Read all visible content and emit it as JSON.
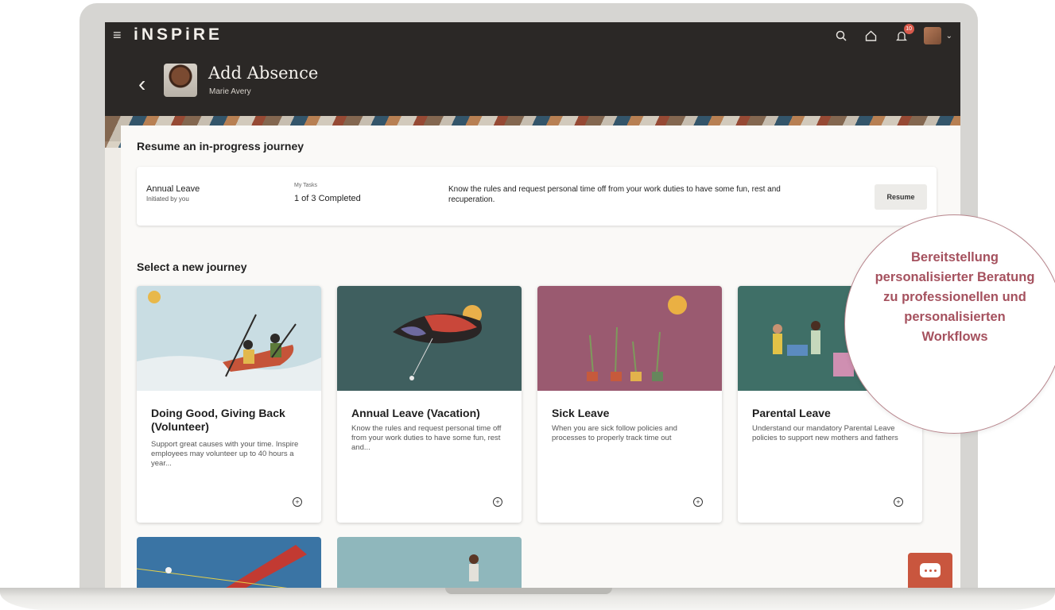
{
  "brand": {
    "name": "iNSPiRE"
  },
  "header": {
    "title": "Add Absence",
    "subtitle": "Marie Avery",
    "notification_count": "10",
    "icons": [
      "menu-icon",
      "search-icon",
      "home-icon",
      "bell-icon",
      "avatar",
      "chevron-down-icon"
    ]
  },
  "resume_section": {
    "heading": "Resume an in-progress journey",
    "item": {
      "title": "Annual Leave",
      "subtitle": "Initiated by you",
      "tasks_label": "My Tasks",
      "tasks_value": "1 of 3 Completed",
      "description": "Know the rules and request personal time off from your work duties to have some fun, rest and recuperation.",
      "button": "Resume"
    }
  },
  "new_section": {
    "heading": "Select a new journey",
    "cards": [
      {
        "title": "Doing Good, Giving Back (Volunteer)",
        "description": "Support great causes with your time. Inspire employees may volunteer up to 40 hours a year..."
      },
      {
        "title": "Annual Leave (Vacation)",
        "description": "Know the rules and request personal time off from your work duties to have some fun, rest and..."
      },
      {
        "title": "Sick Leave",
        "description": "When you are sick follow policies and processes to properly track time out"
      },
      {
        "title": "Parental Leave",
        "description": "Understand our mandatory Parental Leave policies to support new mothers and fathers"
      }
    ]
  },
  "callout": {
    "text": "Bereitstellung personalisierter Beratung zu professionellen und personalisierten Workflows"
  },
  "colors": {
    "topbar": "#2b2826",
    "accent": "#a5515e",
    "chat": "#c9563e"
  }
}
